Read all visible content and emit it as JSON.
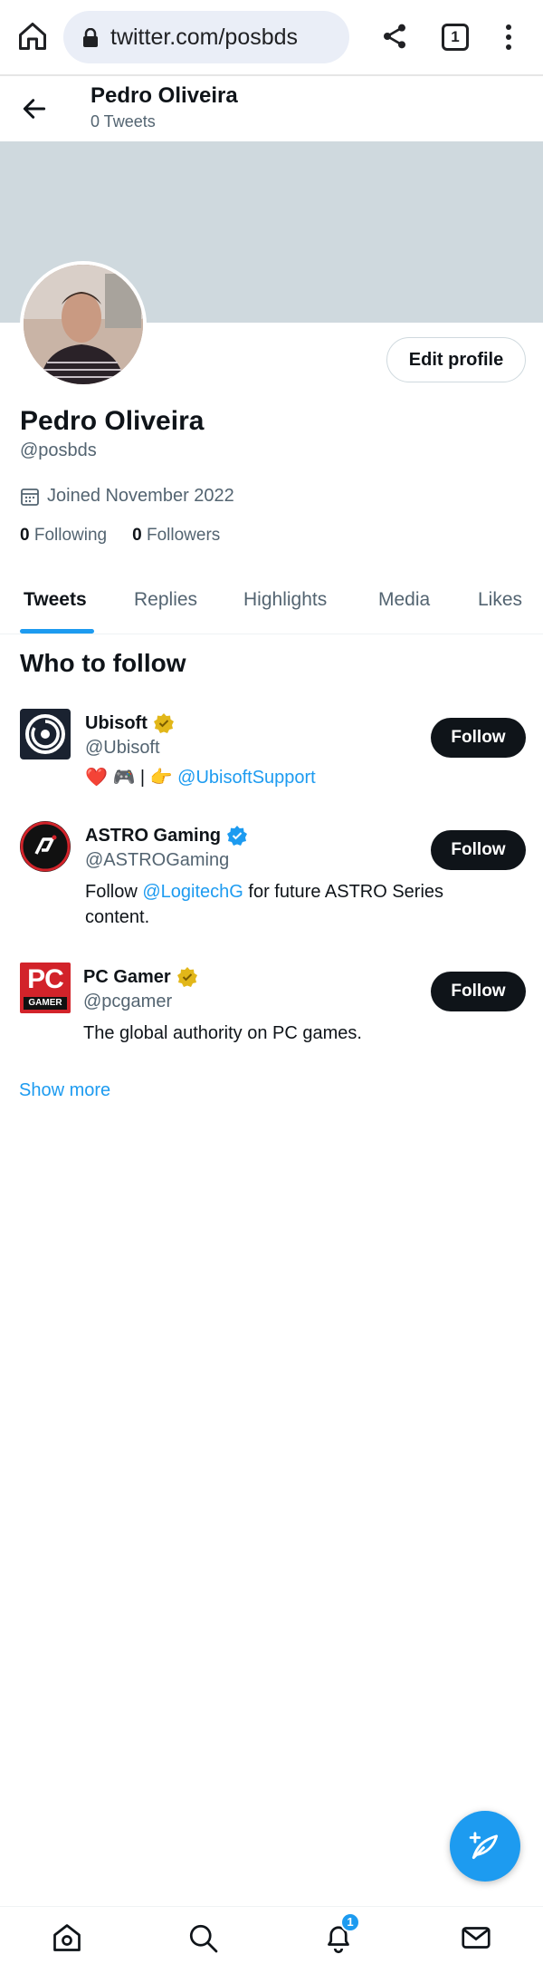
{
  "browser": {
    "url": "twitter.com/posbds",
    "tab_count": "1"
  },
  "header": {
    "name": "Pedro Oliveira",
    "tweet_count": "0 Tweets"
  },
  "profile": {
    "edit_label": "Edit profile",
    "name": "Pedro Oliveira",
    "handle": "@posbds",
    "joined": "Joined November 2022",
    "following_count": "0",
    "following_label": "Following",
    "followers_count": "0",
    "followers_label": "Followers"
  },
  "tabs": [
    {
      "label": "Tweets",
      "active": true
    },
    {
      "label": "Replies"
    },
    {
      "label": "Highlights"
    },
    {
      "label": "Media"
    },
    {
      "label": "Likes"
    }
  ],
  "who_to_follow": {
    "title": "Who to follow",
    "follow_label": "Follow",
    "show_more": "Show more",
    "accounts": [
      {
        "name": "Ubisoft",
        "verified": "gold",
        "handle": "@Ubisoft",
        "bio_prefix": "❤️ 🎮 | 👉 ",
        "bio_link": "@UbisoftSupport",
        "bio_suffix": ""
      },
      {
        "name": "ASTRO Gaming",
        "verified": "blue",
        "handle": "@ASTROGaming",
        "bio_prefix": "Follow ",
        "bio_link": "@LogitechG",
        "bio_suffix": " for future ASTRO Series content."
      },
      {
        "name": "PC Gamer",
        "verified": "gold",
        "handle": "@pcgamer",
        "bio_prefix": "The global authority on PC games.",
        "bio_link": "",
        "bio_suffix": "",
        "logo_text_top": "PC",
        "logo_text_bottom": "GAMER"
      }
    ]
  },
  "notifications_badge": "1",
  "colors": {
    "accent": "#1d9bf0",
    "gold_badge": "#e2b719",
    "banner": "#cfd9de",
    "dark_button": "#0f1419"
  }
}
